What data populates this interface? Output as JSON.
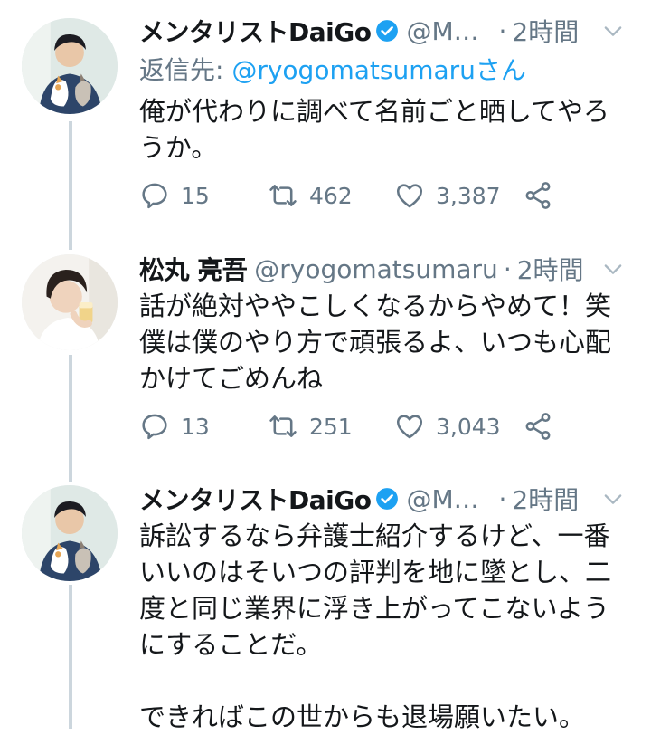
{
  "tweets": [
    {
      "name": "メンタリストDaiGo",
      "verified": true,
      "handle": "@Me...",
      "time": "2時間",
      "reply_prefix": "返信先: ",
      "reply_mention": "@ryogomatsumaru",
      "reply_suffix": "さん",
      "text": "俺が代わりに調べて名前ごと晒してやろ\nうか。",
      "replies": "15",
      "retweets": "462",
      "likes": "3,387"
    },
    {
      "name": "松丸 亮吾",
      "verified": false,
      "handle": "@ryogomatsumaru",
      "time": "2時間",
      "text": "話が絶対ややこしくなるからやめて！笑\n僕は僕のやり方で頑張るよ、いつも心配\nかけてごめんね",
      "replies": "13",
      "retweets": "251",
      "likes": "3,043"
    },
    {
      "name": "メンタリストDaiGo",
      "verified": true,
      "handle": "@Me...",
      "time": "2時間",
      "text": "訴訟するなら弁護士紹介するけど、一番\nいいのはそいつの評判を地に墜とし、二\n度と同じ業界に浮き上がってこないよう\nにすることだ。\n\nできればこの世からも退場願いたい。"
    }
  ],
  "colors": {
    "text": "#14171a",
    "muted": "#657786",
    "accent": "#1da1f2",
    "thread_line": "#ccd6dd"
  },
  "icons": [
    "reply-icon",
    "retweet-icon",
    "like-icon",
    "share-icon",
    "chevron-down-icon",
    "verified-badge-icon"
  ]
}
